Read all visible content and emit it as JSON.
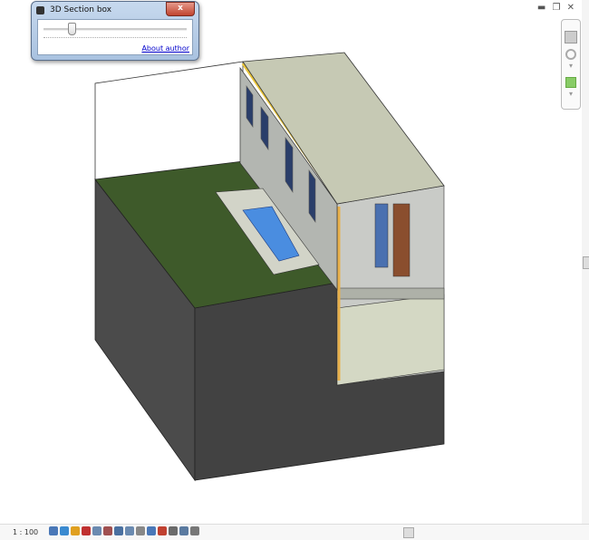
{
  "dialog": {
    "title": "3D Section box",
    "close_label": "x",
    "slider_value_fraction": 0.18,
    "about_link": "About author"
  },
  "window_controls": {
    "minimize": "▬",
    "restore": "❐",
    "close": "✕"
  },
  "nav_bar": {
    "items": [
      "viewcube-icon",
      "steering-wheel-icon",
      "zoom-region-icon"
    ]
  },
  "status_bar": {
    "scale": "1 : 100",
    "icons": [
      "detail-level-icon",
      "visual-style-icon",
      "sun-path-icon",
      "shadows-icon",
      "crop-view-icon",
      "show-crop-icon",
      "unlock-3d-icon",
      "temporary-hide-icon",
      "reveal-hidden-icon",
      "worksharing-icon",
      "design-options-icon",
      "analytical-model-icon",
      "highlight-displacement-icon",
      "render-icon"
    ],
    "icon_colors": [
      "#4a78b8",
      "#3a8ad0",
      "#e0a020",
      "#c03030",
      "#6a8ab0",
      "#a05050",
      "#4a70a0",
      "#6a8ab0",
      "#888",
      "#4a78b8",
      "#c04030",
      "#6a6a6a",
      "#5a7aa0",
      "#777"
    ]
  },
  "colors": {
    "grass": "#3e5a2a",
    "earth": "#4a4a4a",
    "wall": "#b9bcb6",
    "roof": "#c6c9b4",
    "glass": "#4a8de0",
    "door": "#8a4e2e"
  }
}
